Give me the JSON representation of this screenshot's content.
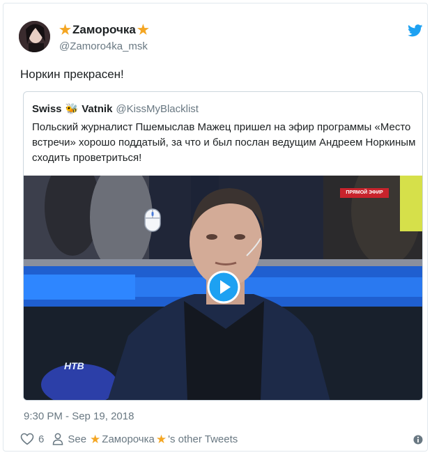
{
  "author": {
    "name": "Zaморочка",
    "star_icon": "star-icon",
    "handle": "@Zamoro4ka_msk"
  },
  "tweet": {
    "text": "Норкин прекрасен!"
  },
  "quoted": {
    "name_first": "Swiss",
    "emoji": "🐝",
    "name_second": "Vatnik",
    "handle": "@KissMyBlacklist",
    "text": "Польский журналист Пшемыслав Мажец пришел на эфир программы «Место встречи» хорошо поддатый, за что и был послан ведущим Андреем Норкиным сходить проветриться!",
    "media": {
      "live_badge": "ПРЯМОЙ ЭФИР",
      "channel_logo": "НТВ"
    }
  },
  "footer": {
    "timestamp": "9:30 PM - Sep 19, 2018",
    "likes": "6",
    "see_prefix": "See",
    "see_name": "Zaморочка",
    "see_suffix": "'s other Tweets"
  },
  "colors": {
    "twitter_blue": "#1da1f2",
    "star": "#f4a623",
    "muted": "#697882"
  }
}
